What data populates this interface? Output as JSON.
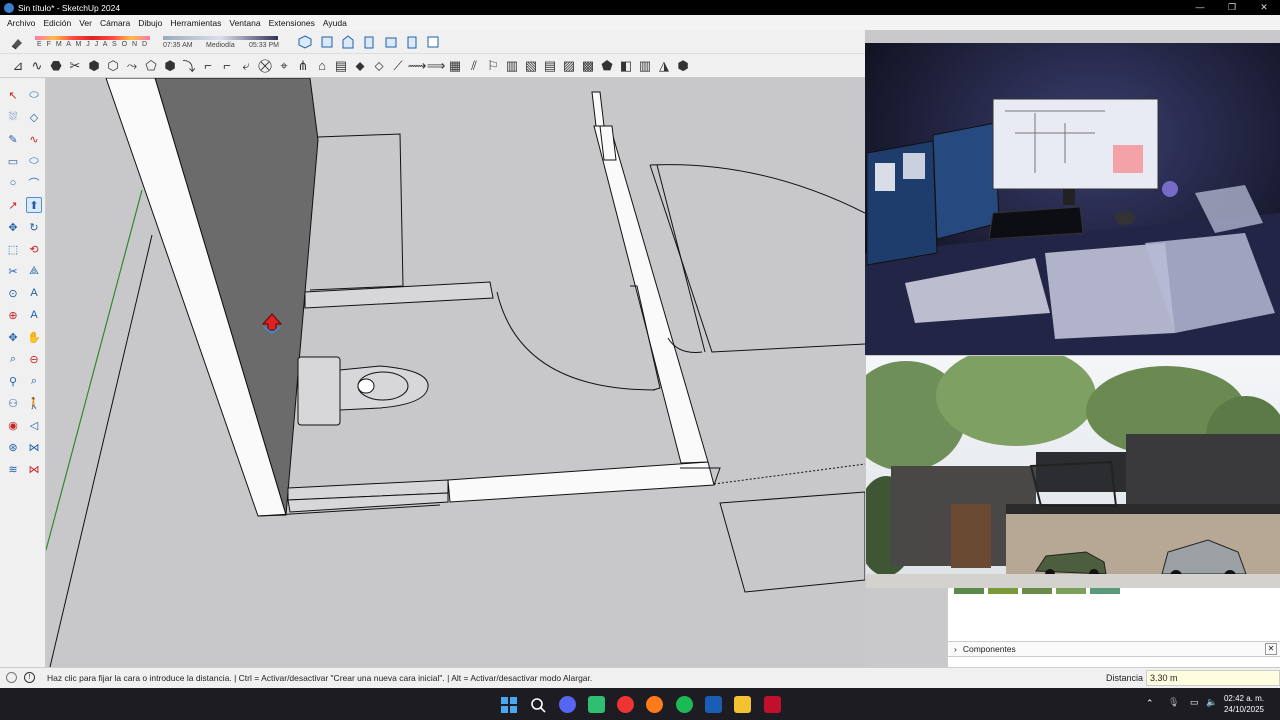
{
  "window": {
    "title": "Sin título* - SketchUp 2024",
    "minimize": "—",
    "restore": "❐",
    "close": "✕"
  },
  "menu": [
    "Archivo",
    "Edición",
    "Ver",
    "Cámara",
    "Dibujo",
    "Herramientas",
    "Ventana",
    "Extensiones",
    "Ayuda"
  ],
  "shadows": {
    "months": "E F M A M J J A S O N D",
    "time_start": "07:35 AM",
    "time_mid": "Mediodía",
    "time_end": "05:33 PM"
  },
  "tray": {
    "panel_title": "Componentes"
  },
  "status": {
    "message": "Haz clic para fijar la cara o introduce la distancia. | Ctrl = Activar/desactivar \"Crear una nueva cara inicial\". | Alt = Activar/desactivar modo Alargar.",
    "vcb_label": "Distancia",
    "vcb_value": "3.30 m"
  },
  "taskbar": {
    "time": "02:42 a. m.",
    "date": "24/10/2025"
  },
  "colors": {
    "accent": "#4a90d9",
    "face_dark": "#6b6b6b",
    "viewport_bg": "#c8c8cb",
    "axis_green": "#2e8b2e"
  },
  "icons": [
    "select-icon",
    "paint-icon",
    "eraser-icon",
    "line-icon",
    "rectangle-icon",
    "circle-icon",
    "arc-icon",
    "push-pull-icon",
    "move-icon",
    "rotate-icon",
    "scale-icon",
    "offset-icon",
    "tape-icon",
    "text-icon",
    "axes-icon",
    "orbit-icon",
    "pan-icon",
    "zoom-icon",
    "walk-icon",
    "section-icon"
  ]
}
